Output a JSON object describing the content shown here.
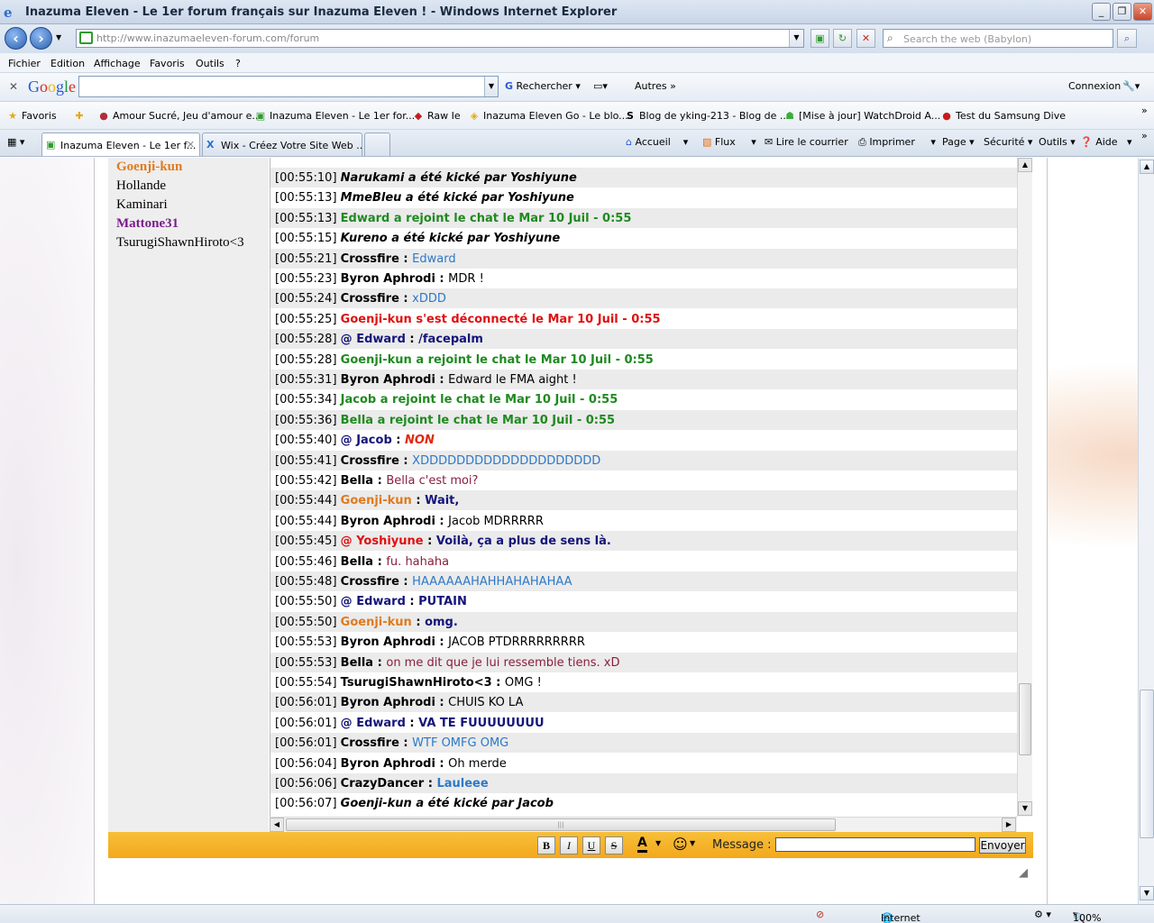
{
  "window": {
    "title": "Inazuma Eleven - Le 1er forum français sur Inazuma Eleven ! - Windows Internet Explorer",
    "min_icon": "minimize-icon",
    "max_icon": "maximize-icon",
    "close_icon": "close-icon"
  },
  "address_bar": {
    "url": "http://www.inazumaeleven-forum.com/forum",
    "search_placeholder": "Search the web (Babylon)"
  },
  "menu": [
    "Fichier",
    "Edition",
    "Affichage",
    "Favoris",
    "Outils",
    "?"
  ],
  "google_toolbar": {
    "logo": "Google",
    "search_label": "Rechercher",
    "more_label": "Autres",
    "connect_label": "Connexion"
  },
  "favorites_bar": {
    "favorites_label": "Favoris",
    "items": [
      "Amour Sucré, Jeu d'amour e...",
      "Inazuma Eleven - Le 1er for...",
      "Raw Ie",
      "Inazuma Eleven Go - Le blo...",
      "Blog de yking-213 - Blog de ...",
      "[Mise à jour] WatchDroid  A...",
      "Test du Samsung Dive"
    ]
  },
  "tabs": [
    {
      "label": "Inazuma Eleven - Le 1er f..."
    },
    {
      "label": "Wix - Créez Votre Site Web ..."
    }
  ],
  "command_bar": [
    "Accueil",
    "Flux",
    "Lire le courrier",
    "Imprimer",
    "Page",
    "Sécurité",
    "Outils",
    "Aide"
  ],
  "user_list": [
    {
      "name": "Goenji-kun",
      "color": "#e07a1c",
      "bold": true
    },
    {
      "name": "Hollande",
      "color": "#000000",
      "bold": false
    },
    {
      "name": "Kaminari",
      "color": "#000000",
      "bold": false
    },
    {
      "name": "Mattone31",
      "color": "#7a1e8c",
      "bold": true
    },
    {
      "name": "TsurugiShawnHiroto<3",
      "color": "#000000",
      "bold": false
    }
  ],
  "chat": [
    {
      "time": "[00:55:10]",
      "name": "Narukami a été kické par Yoshiyune",
      "name_color": "#000000",
      "italic": true,
      "msg": "",
      "msg_color": "#000000"
    },
    {
      "time": "[00:55:13]",
      "name": "MmeBleu a été kické par Yoshiyune",
      "name_color": "#000000",
      "italic": true,
      "msg": "",
      "msg_color": "#000000"
    },
    {
      "time": "[00:55:13]",
      "name": "Edward a rejoint le chat le Mar 10 Juil - 0:55",
      "name_color": "#1f8a1f",
      "italic": false,
      "msg": "",
      "msg_color": "#000000"
    },
    {
      "time": "[00:55:15]",
      "name": "Kureno a été kické par Yoshiyune",
      "name_color": "#000000",
      "italic": true,
      "msg": "",
      "msg_color": "#000000"
    },
    {
      "time": "[00:55:21]",
      "name": "Crossfire",
      "name_color": "#000000",
      "italic": false,
      "msg": "Edward",
      "msg_color": "#2d78c8"
    },
    {
      "time": "[00:55:23]",
      "name": "Byron Aphrodi",
      "name_color": "#000000",
      "italic": false,
      "msg": "MDR !",
      "msg_color": "#000000"
    },
    {
      "time": "[00:55:24]",
      "name": "Crossfire",
      "name_color": "#000000",
      "italic": false,
      "msg": "xDDD",
      "msg_color": "#2d78c8"
    },
    {
      "time": "[00:55:25]",
      "name": "Goenji-kun s'est déconnecté le Mar 10 Juil - 0:55",
      "name_color": "#e01010",
      "italic": false,
      "msg": "",
      "msg_color": "#000000"
    },
    {
      "time": "[00:55:28]",
      "name": "@ Edward",
      "name_color": "#14147a",
      "italic": false,
      "msg": "/facepalm",
      "msg_color": "#14147a",
      "msg_bold": true
    },
    {
      "time": "[00:55:28]",
      "name": "Goenji-kun a rejoint le chat le Mar 10 Juil - 0:55",
      "name_color": "#1f8a1f",
      "italic": false,
      "msg": "",
      "msg_color": "#000000"
    },
    {
      "time": "[00:55:31]",
      "name": "Byron Aphrodi",
      "name_color": "#000000",
      "italic": false,
      "msg": "Edward le FMA aight !",
      "msg_color": "#000000"
    },
    {
      "time": "[00:55:34]",
      "name": "Jacob a rejoint le chat le Mar 10 Juil - 0:55",
      "name_color": "#1f8a1f",
      "italic": false,
      "msg": "",
      "msg_color": "#000000"
    },
    {
      "time": "[00:55:36]",
      "name": "Bella a rejoint le chat le Mar 10 Juil - 0:55",
      "name_color": "#1f8a1f",
      "italic": false,
      "msg": "",
      "msg_color": "#000000"
    },
    {
      "time": "[00:55:40]",
      "name": "@ Jacob",
      "name_color": "#14147a",
      "italic": false,
      "msg": "NON",
      "msg_color": "#e02a10",
      "msg_bold": true,
      "msg_italic": true
    },
    {
      "time": "[00:55:41]",
      "name": "Crossfire",
      "name_color": "#000000",
      "italic": false,
      "msg": "XDDDDDDDDDDDDDDDDDDDD",
      "msg_color": "#2d78c8"
    },
    {
      "time": "[00:55:42]",
      "name": "Bella",
      "name_color": "#000000",
      "italic": false,
      "msg": "Bella c'est moi?",
      "msg_color": "#8a1e3c"
    },
    {
      "time": "[00:55:44]",
      "name": "Goenji-kun",
      "name_color": "#e07a1c",
      "italic": false,
      "msg": "Wait,",
      "msg_color": "#14147a",
      "msg_bold": true
    },
    {
      "time": "[00:55:44]",
      "name": "Byron Aphrodi",
      "name_color": "#000000",
      "italic": false,
      "msg": "Jacob MDRRRRR",
      "msg_color": "#000000"
    },
    {
      "time": "[00:55:45]",
      "name": "@ Yoshiyune",
      "name_color": "#e01010",
      "italic": false,
      "msg": "Voilà, ça a plus de sens là.",
      "msg_color": "#14147a",
      "msg_bold": true
    },
    {
      "time": "[00:55:46]",
      "name": "Bella",
      "name_color": "#000000",
      "italic": false,
      "msg": "fu. hahaha",
      "msg_color": "#8a1e3c"
    },
    {
      "time": "[00:55:48]",
      "name": "Crossfire",
      "name_color": "#000000",
      "italic": false,
      "msg": "HAAAAAAHAHHAHAHAHAA",
      "msg_color": "#2d78c8"
    },
    {
      "time": "[00:55:50]",
      "name": "@ Edward",
      "name_color": "#14147a",
      "italic": false,
      "msg": "PUTAIN",
      "msg_color": "#14147a",
      "msg_bold": true
    },
    {
      "time": "[00:55:50]",
      "name": "Goenji-kun",
      "name_color": "#e07a1c",
      "italic": false,
      "msg": "omg.",
      "msg_color": "#14147a",
      "msg_bold": true
    },
    {
      "time": "[00:55:53]",
      "name": "Byron Aphrodi",
      "name_color": "#000000",
      "italic": false,
      "msg": "JACOB PTDRRRRRRRRR",
      "msg_color": "#000000"
    },
    {
      "time": "[00:55:53]",
      "name": "Bella",
      "name_color": "#000000",
      "italic": false,
      "msg": "on me dit que je lui ressemble tiens. xD",
      "msg_color": "#8a1e3c"
    },
    {
      "time": "[00:55:54]",
      "name": "TsurugiShawnHiroto<3",
      "name_color": "#000000",
      "italic": false,
      "msg": "OMG !",
      "msg_color": "#000000"
    },
    {
      "time": "[00:56:01]",
      "name": "Byron Aphrodi",
      "name_color": "#000000",
      "italic": false,
      "msg": "CHUIS KO LA",
      "msg_color": "#000000"
    },
    {
      "time": "[00:56:01]",
      "name": "@ Edward",
      "name_color": "#14147a",
      "italic": false,
      "msg": "VA TE FUUUUUUUU",
      "msg_color": "#14147a",
      "msg_bold": true
    },
    {
      "time": "[00:56:01]",
      "name": "Crossfire",
      "name_color": "#000000",
      "italic": false,
      "msg": "WTF OMFG OMG",
      "msg_color": "#2d78c8"
    },
    {
      "time": "[00:56:04]",
      "name": "Byron Aphrodi",
      "name_color": "#000000",
      "italic": false,
      "msg": "Oh merde",
      "msg_color": "#000000"
    },
    {
      "time": "[00:56:06]",
      "name": "CrazyDancer",
      "name_color": "#000000",
      "italic": false,
      "msg": "Lauleee",
      "msg_color": "#2d78c8",
      "msg_bold": true
    },
    {
      "time": "[00:56:07]",
      "name": "Goenji-kun a été kické par Jacob",
      "name_color": "#000000",
      "italic": true,
      "msg": "",
      "msg_color": "#000000"
    }
  ],
  "post_bar": {
    "bold_label": "B",
    "italic_label": "I",
    "underline_label": "U",
    "strike_label": "S",
    "color_label": "A",
    "message_label": "Message :",
    "message_value": "",
    "send_label": "Envoyer"
  },
  "status_bar": {
    "zone": "Internet",
    "zoom": "100%"
  }
}
